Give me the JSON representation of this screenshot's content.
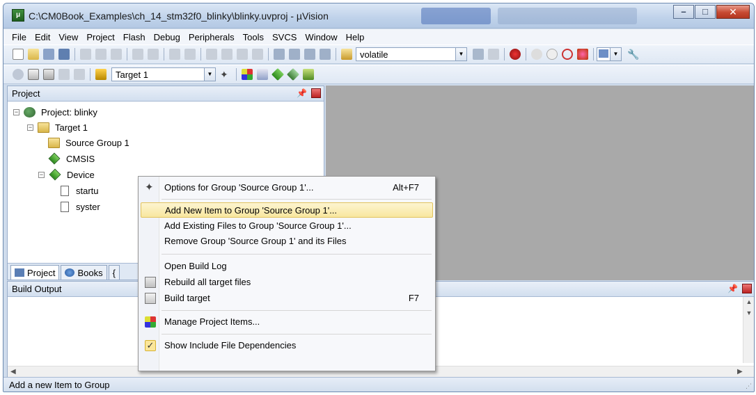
{
  "window": {
    "title": "C:\\CM0Book_Examples\\ch_14_stm32f0_blinky\\blinky.uvproj - µVision",
    "app_icon": "uv-icon"
  },
  "menu": {
    "items": [
      "File",
      "Edit",
      "View",
      "Project",
      "Flash",
      "Debug",
      "Peripherals",
      "Tools",
      "SVCS",
      "Window",
      "Help"
    ]
  },
  "toolbar1": {
    "search_combo_value": "volatile"
  },
  "toolbar2": {
    "target_combo_value": "Target 1"
  },
  "project_panel": {
    "title": "Project",
    "tree": {
      "project": "Project: blinky",
      "target": "Target 1",
      "source_group": "Source Group 1",
      "cmsis": "CMSIS",
      "device": "Device",
      "file1": "startu",
      "file2": "syster"
    },
    "tabs": {
      "project": "Project",
      "books": "Books",
      "functions": "{"
    }
  },
  "build_output": {
    "title": "Build Output"
  },
  "status_bar": {
    "text": "Add a new Item to Group"
  },
  "context_menu": {
    "items": [
      {
        "label": "Options for Group 'Source Group 1'...",
        "shortcut": "Alt+F7",
        "icon": "options-icon"
      },
      {
        "label": "Add New  Item to Group 'Source Group 1'...",
        "shortcut": "",
        "highlighted": true
      },
      {
        "label": "Add Existing Files to Group 'Source Group 1'...",
        "shortcut": ""
      },
      {
        "label": "Remove Group 'Source Group 1' and its Files",
        "shortcut": ""
      },
      {
        "label": "Open Build Log",
        "shortcut": ""
      },
      {
        "label": "Rebuild all target files",
        "shortcut": "",
        "icon": "rebuild-icon"
      },
      {
        "label": "Build target",
        "shortcut": "F7",
        "icon": "build-icon"
      },
      {
        "label": "Manage Project Items...",
        "shortcut": "",
        "icon": "manage-icon"
      },
      {
        "label": "Show Include File Dependencies",
        "shortcut": "",
        "checked": true
      }
    ]
  },
  "colors": {
    "menu_highlight": "#f8e79f",
    "editor_background": "#a9a9a9",
    "title_bar": "#bfd2ea"
  }
}
